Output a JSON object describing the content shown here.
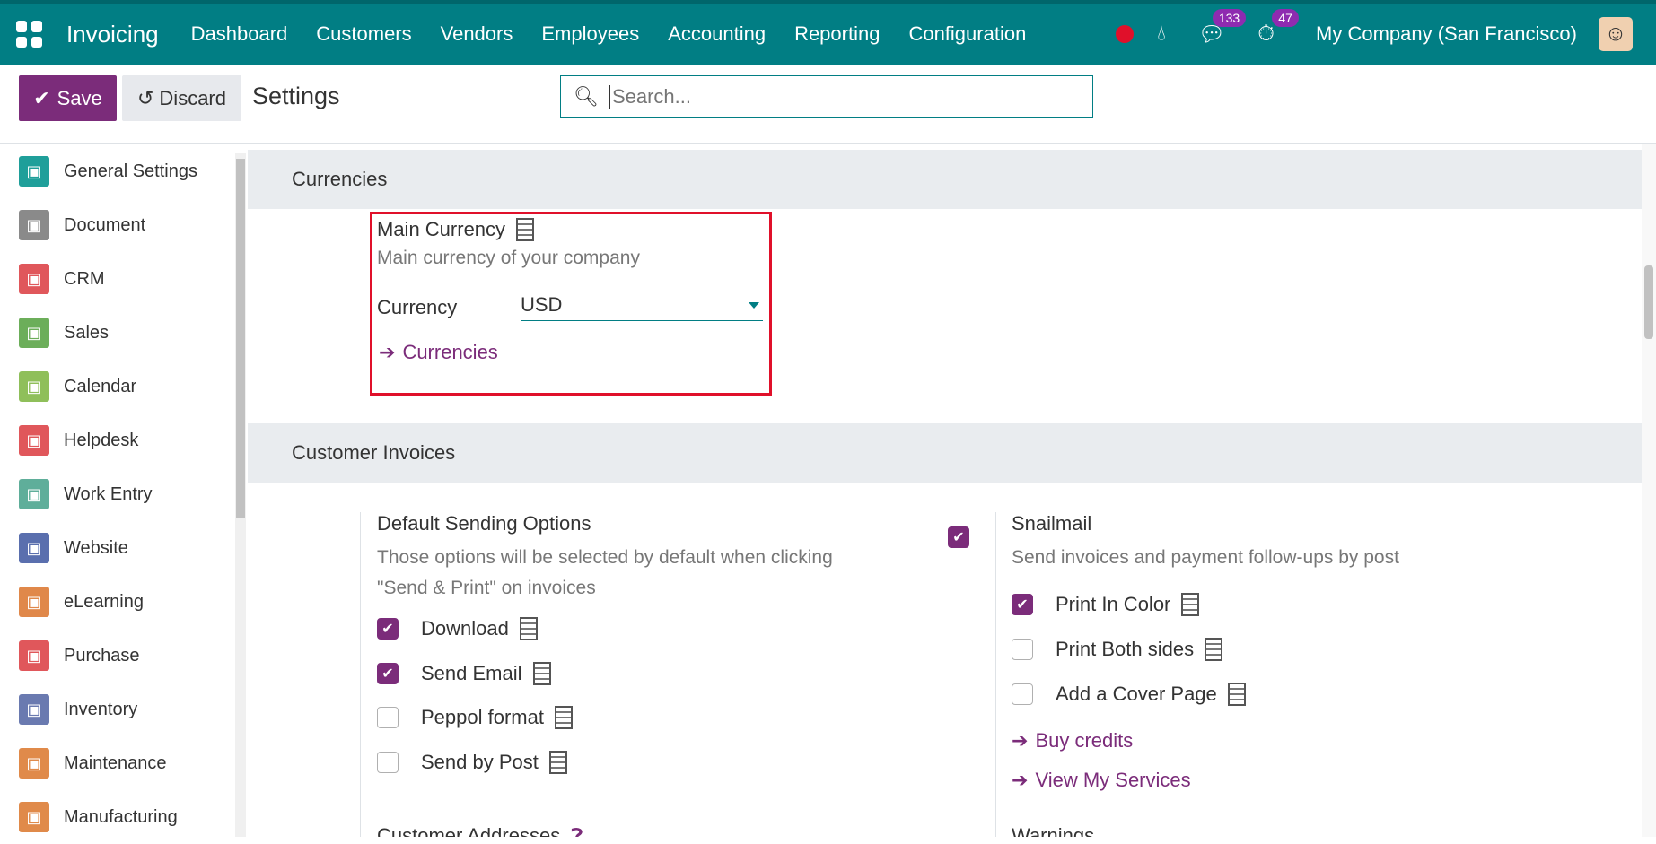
{
  "app": {
    "name": "Invoicing"
  },
  "menu": [
    "Dashboard",
    "Customers",
    "Vendors",
    "Employees",
    "Accounting",
    "Reporting",
    "Configuration"
  ],
  "systray": {
    "messages_count": "133",
    "activities_count": "47",
    "company": "My Company (San Francisco)"
  },
  "control": {
    "save_label": "Save",
    "discard_label": "Discard",
    "title": "Settings",
    "search_placeholder": "Search..."
  },
  "sidebar": {
    "items": [
      {
        "label": "General Settings",
        "icon": "gear-icon",
        "color": "#1f9f9a"
      },
      {
        "label": "Document",
        "icon": "document-icon",
        "color": "#8a8a8a"
      },
      {
        "label": "CRM",
        "icon": "handshake-icon",
        "color": "#e0575b"
      },
      {
        "label": "Sales",
        "icon": "chart-icon",
        "color": "#6cae5a"
      },
      {
        "label": "Calendar",
        "icon": "calendar-icon",
        "color": "#8fbf5a"
      },
      {
        "label": "Helpdesk",
        "icon": "helpdesk-icon",
        "color": "#e0575b"
      },
      {
        "label": "Work Entry",
        "icon": "work-entry-icon",
        "color": "#5fae9a"
      },
      {
        "label": "Website",
        "icon": "globe-icon",
        "color": "#5a6fae"
      },
      {
        "label": "eLearning",
        "icon": "elearning-icon",
        "color": "#e0884a"
      },
      {
        "label": "Purchase",
        "icon": "purchase-icon",
        "color": "#e0575b"
      },
      {
        "label": "Inventory",
        "icon": "box-icon",
        "color": "#6a7ab0"
      },
      {
        "label": "Maintenance",
        "icon": "maintenance-icon",
        "color": "#e08a4a"
      },
      {
        "label": "Manufacturing",
        "icon": "manufacturing-icon",
        "color": "#e08a4a"
      }
    ]
  },
  "currencies": {
    "section_title": "Currencies",
    "main_currency_title": "Main Currency",
    "main_currency_desc": "Main currency of your company",
    "currency_label": "Currency",
    "currency_value": "USD",
    "currencies_link": "Currencies"
  },
  "customer_invoices": {
    "section_title": "Customer Invoices",
    "default_sending": {
      "title": "Default Sending Options",
      "desc": "Those options will be selected by default when clicking \"Send & Print\" on invoices",
      "enabled": true,
      "options": [
        {
          "label": "Download",
          "checked": true
        },
        {
          "label": "Send Email",
          "checked": true
        },
        {
          "label": "Peppol format",
          "checked": false
        },
        {
          "label": "Send by Post",
          "checked": false
        }
      ]
    },
    "snailmail": {
      "title": "Snailmail",
      "desc": "Send invoices and payment follow-ups by post",
      "options": [
        {
          "label": "Print In Color",
          "checked": true
        },
        {
          "label": "Print Both sides",
          "checked": false
        },
        {
          "label": "Add a Cover Page",
          "checked": false
        }
      ],
      "links": [
        "Buy credits",
        "View My Services"
      ]
    },
    "next_row": {
      "left": "Customer Addresses",
      "right": "Warnings"
    }
  }
}
